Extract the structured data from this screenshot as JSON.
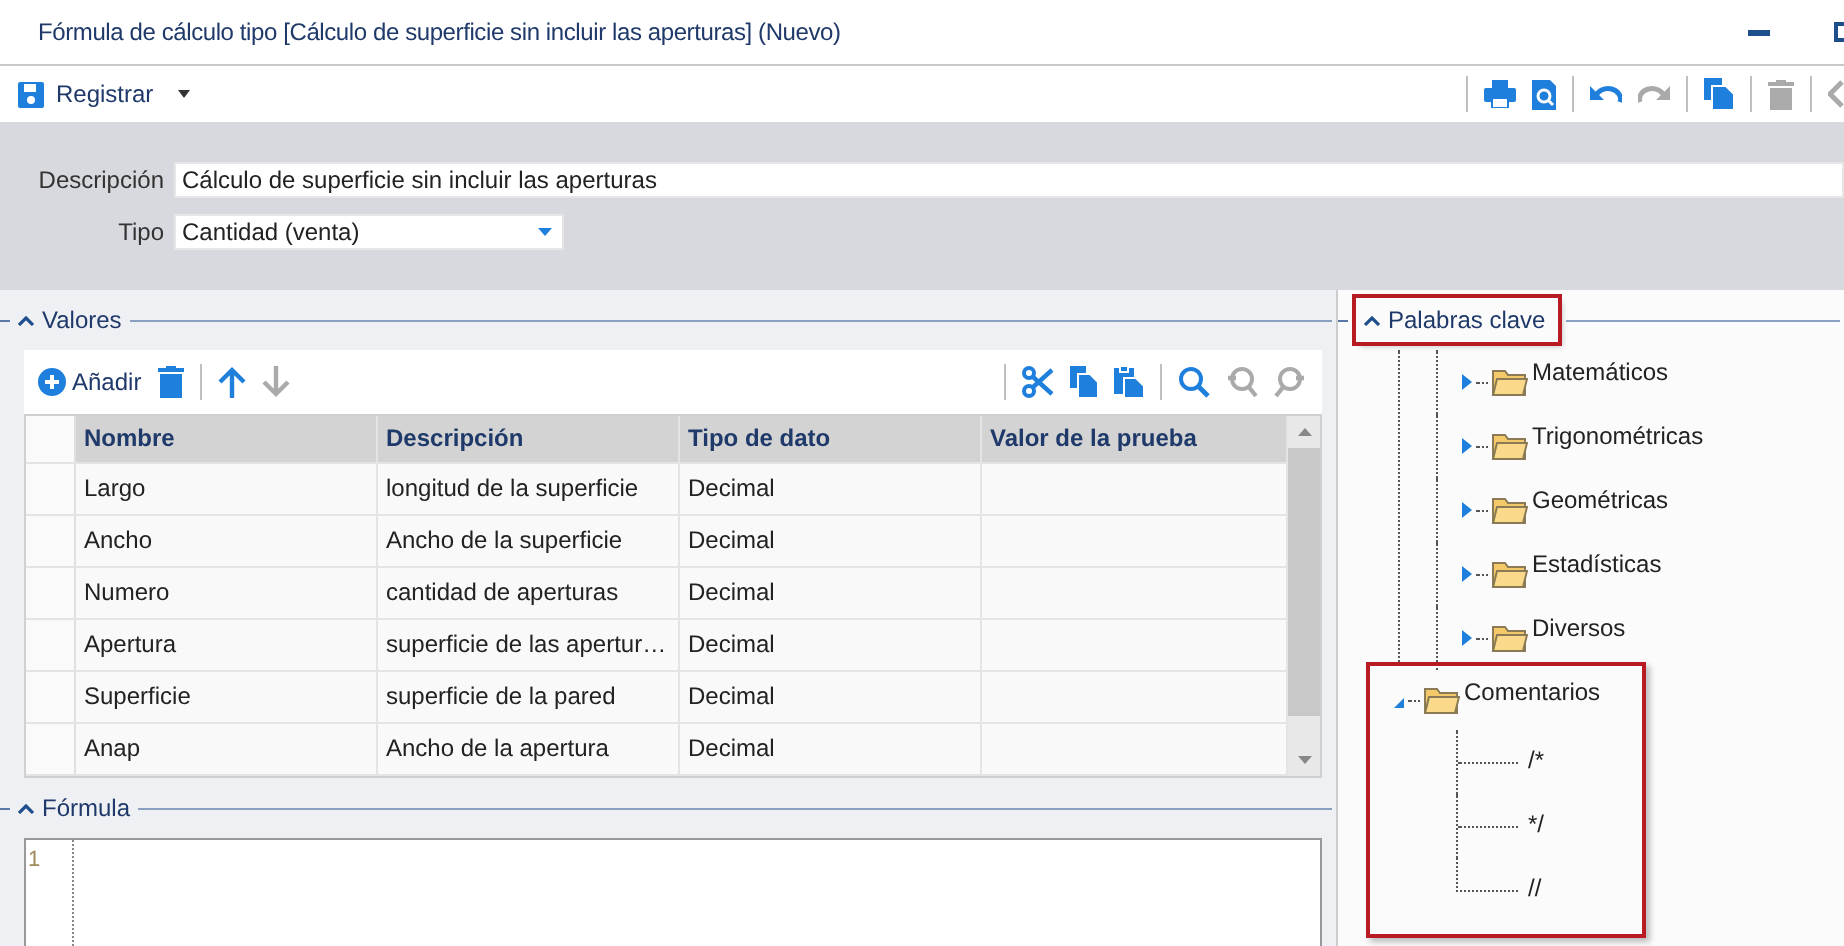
{
  "window": {
    "title": "Fórmula de cálculo tipo [Cálculo de superficie sin incluir las aperturas] (Nuevo)"
  },
  "toolbar": {
    "save_label": "Registrar"
  },
  "form": {
    "description_label": "Descripción",
    "description_value": "Cálculo de superficie sin incluir las aperturas",
    "type_label": "Tipo",
    "type_value": "Cantidad (venta)"
  },
  "values_section": {
    "title": "Valores",
    "add_label": "Añadir",
    "columns": [
      "Nombre",
      "Descripción",
      "Tipo de dato",
      "Valor de la prueba"
    ],
    "rows": [
      {
        "name": "Largo",
        "description": "longitud de la superficie",
        "type": "Decimal"
      },
      {
        "name": "Ancho",
        "description": "Ancho de la superficie",
        "type": "Decimal"
      },
      {
        "name": "Numero",
        "description": "cantidad de aperturas",
        "type": "Decimal"
      },
      {
        "name": "Apertura",
        "description": "superficie de las apertur…",
        "type": "Decimal"
      },
      {
        "name": "Superficie",
        "description": "superficie de la pared",
        "type": "Decimal"
      },
      {
        "name": "Anap",
        "description": "Ancho de la apertura",
        "type": "Decimal"
      }
    ]
  },
  "formula_section": {
    "title": "Fórmula",
    "line_numbers": [
      "1"
    ]
  },
  "keywords_section": {
    "title": "Palabras clave",
    "highlighted": true,
    "tree": [
      {
        "label": "Matemáticos",
        "expanded": false,
        "highlighted": false
      },
      {
        "label": "Trigonométricas",
        "expanded": false,
        "highlighted": false
      },
      {
        "label": "Geométricas",
        "expanded": false,
        "highlighted": false
      },
      {
        "label": "Estadísticas",
        "expanded": false,
        "highlighted": false
      },
      {
        "label": "Diversos",
        "expanded": false,
        "highlighted": false
      },
      {
        "label": "Comentarios",
        "expanded": true,
        "highlighted": true,
        "children": [
          {
            "label": "/*"
          },
          {
            "label": "*/"
          },
          {
            "label": "//"
          }
        ]
      }
    ]
  }
}
